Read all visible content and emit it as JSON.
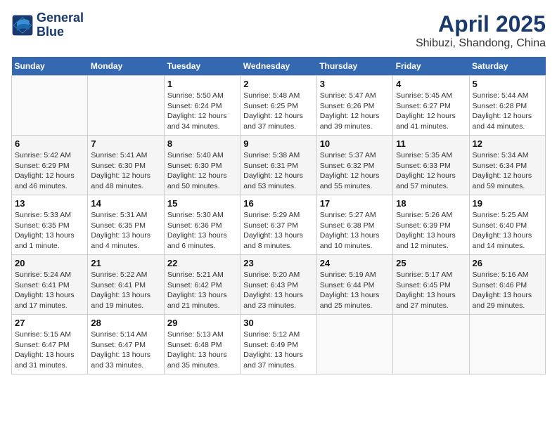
{
  "header": {
    "logo_line1": "General",
    "logo_line2": "Blue",
    "title": "April 2025",
    "subtitle": "Shibuzi, Shandong, China"
  },
  "calendar": {
    "days_of_week": [
      "Sunday",
      "Monday",
      "Tuesday",
      "Wednesday",
      "Thursday",
      "Friday",
      "Saturday"
    ],
    "weeks": [
      [
        {
          "day": "",
          "detail": "",
          "empty": true
        },
        {
          "day": "",
          "detail": "",
          "empty": true
        },
        {
          "day": "1",
          "detail": "Sunrise: 5:50 AM\nSunset: 6:24 PM\nDaylight: 12 hours\nand 34 minutes."
        },
        {
          "day": "2",
          "detail": "Sunrise: 5:48 AM\nSunset: 6:25 PM\nDaylight: 12 hours\nand 37 minutes."
        },
        {
          "day": "3",
          "detail": "Sunrise: 5:47 AM\nSunset: 6:26 PM\nDaylight: 12 hours\nand 39 minutes."
        },
        {
          "day": "4",
          "detail": "Sunrise: 5:45 AM\nSunset: 6:27 PM\nDaylight: 12 hours\nand 41 minutes."
        },
        {
          "day": "5",
          "detail": "Sunrise: 5:44 AM\nSunset: 6:28 PM\nDaylight: 12 hours\nand 44 minutes."
        }
      ],
      [
        {
          "day": "6",
          "detail": "Sunrise: 5:42 AM\nSunset: 6:29 PM\nDaylight: 12 hours\nand 46 minutes."
        },
        {
          "day": "7",
          "detail": "Sunrise: 5:41 AM\nSunset: 6:30 PM\nDaylight: 12 hours\nand 48 minutes."
        },
        {
          "day": "8",
          "detail": "Sunrise: 5:40 AM\nSunset: 6:30 PM\nDaylight: 12 hours\nand 50 minutes."
        },
        {
          "day": "9",
          "detail": "Sunrise: 5:38 AM\nSunset: 6:31 PM\nDaylight: 12 hours\nand 53 minutes."
        },
        {
          "day": "10",
          "detail": "Sunrise: 5:37 AM\nSunset: 6:32 PM\nDaylight: 12 hours\nand 55 minutes."
        },
        {
          "day": "11",
          "detail": "Sunrise: 5:35 AM\nSunset: 6:33 PM\nDaylight: 12 hours\nand 57 minutes."
        },
        {
          "day": "12",
          "detail": "Sunrise: 5:34 AM\nSunset: 6:34 PM\nDaylight: 12 hours\nand 59 minutes."
        }
      ],
      [
        {
          "day": "13",
          "detail": "Sunrise: 5:33 AM\nSunset: 6:35 PM\nDaylight: 13 hours\nand 1 minute."
        },
        {
          "day": "14",
          "detail": "Sunrise: 5:31 AM\nSunset: 6:35 PM\nDaylight: 13 hours\nand 4 minutes."
        },
        {
          "day": "15",
          "detail": "Sunrise: 5:30 AM\nSunset: 6:36 PM\nDaylight: 13 hours\nand 6 minutes."
        },
        {
          "day": "16",
          "detail": "Sunrise: 5:29 AM\nSunset: 6:37 PM\nDaylight: 13 hours\nand 8 minutes."
        },
        {
          "day": "17",
          "detail": "Sunrise: 5:27 AM\nSunset: 6:38 PM\nDaylight: 13 hours\nand 10 minutes."
        },
        {
          "day": "18",
          "detail": "Sunrise: 5:26 AM\nSunset: 6:39 PM\nDaylight: 13 hours\nand 12 minutes."
        },
        {
          "day": "19",
          "detail": "Sunrise: 5:25 AM\nSunset: 6:40 PM\nDaylight: 13 hours\nand 14 minutes."
        }
      ],
      [
        {
          "day": "20",
          "detail": "Sunrise: 5:24 AM\nSunset: 6:41 PM\nDaylight: 13 hours\nand 17 minutes."
        },
        {
          "day": "21",
          "detail": "Sunrise: 5:22 AM\nSunset: 6:41 PM\nDaylight: 13 hours\nand 19 minutes."
        },
        {
          "day": "22",
          "detail": "Sunrise: 5:21 AM\nSunset: 6:42 PM\nDaylight: 13 hours\nand 21 minutes."
        },
        {
          "day": "23",
          "detail": "Sunrise: 5:20 AM\nSunset: 6:43 PM\nDaylight: 13 hours\nand 23 minutes."
        },
        {
          "day": "24",
          "detail": "Sunrise: 5:19 AM\nSunset: 6:44 PM\nDaylight: 13 hours\nand 25 minutes."
        },
        {
          "day": "25",
          "detail": "Sunrise: 5:17 AM\nSunset: 6:45 PM\nDaylight: 13 hours\nand 27 minutes."
        },
        {
          "day": "26",
          "detail": "Sunrise: 5:16 AM\nSunset: 6:46 PM\nDaylight: 13 hours\nand 29 minutes."
        }
      ],
      [
        {
          "day": "27",
          "detail": "Sunrise: 5:15 AM\nSunset: 6:47 PM\nDaylight: 13 hours\nand 31 minutes."
        },
        {
          "day": "28",
          "detail": "Sunrise: 5:14 AM\nSunset: 6:47 PM\nDaylight: 13 hours\nand 33 minutes."
        },
        {
          "day": "29",
          "detail": "Sunrise: 5:13 AM\nSunset: 6:48 PM\nDaylight: 13 hours\nand 35 minutes."
        },
        {
          "day": "30",
          "detail": "Sunrise: 5:12 AM\nSunset: 6:49 PM\nDaylight: 13 hours\nand 37 minutes."
        },
        {
          "day": "",
          "detail": "",
          "empty": true
        },
        {
          "day": "",
          "detail": "",
          "empty": true
        },
        {
          "day": "",
          "detail": "",
          "empty": true
        }
      ]
    ]
  }
}
